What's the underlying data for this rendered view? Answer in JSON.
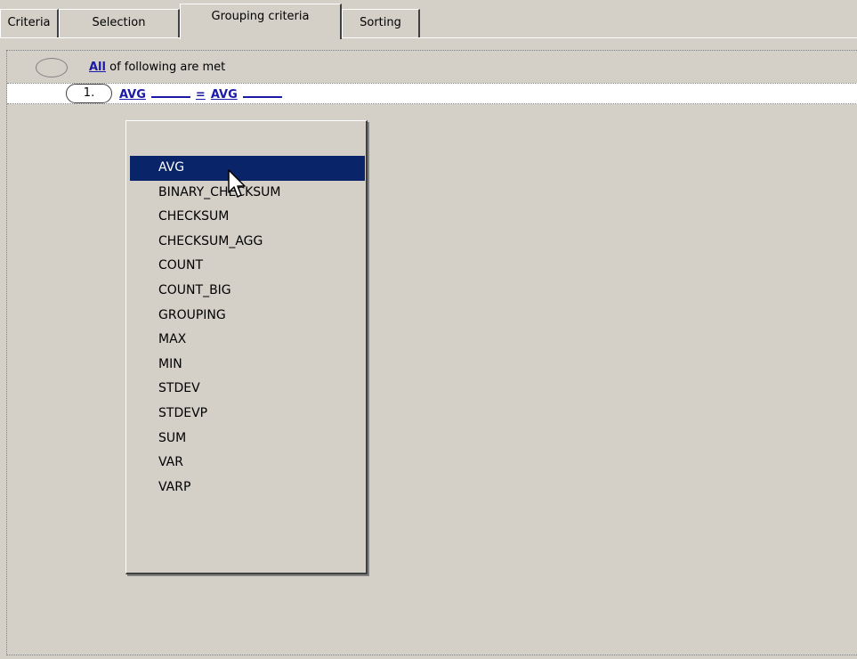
{
  "tabs": [
    {
      "label": "Criteria",
      "active": false
    },
    {
      "label": "Selection",
      "active": false
    },
    {
      "label": "Grouping criteria",
      "active": true
    },
    {
      "label": "Sorting",
      "active": false
    }
  ],
  "condition_group": {
    "quantifier": "All",
    "text": " of following are met"
  },
  "row": {
    "number": "1.",
    "left_function": "AVG",
    "operator": "=",
    "right_function": "AVG"
  },
  "dropdown": {
    "selected": "AVG",
    "items": [
      "AVG",
      "BINARY_CHECKSUM",
      "CHECKSUM",
      "CHECKSUM_AGG",
      "COUNT",
      "COUNT_BIG",
      "GROUPING",
      "MAX",
      "MIN",
      "STDEV",
      "STDEVP",
      "SUM",
      "VAR",
      "VARP"
    ]
  },
  "colors": {
    "background": "#d4d0c8",
    "link": "#1a1aa6",
    "selection": "#0a246a"
  }
}
